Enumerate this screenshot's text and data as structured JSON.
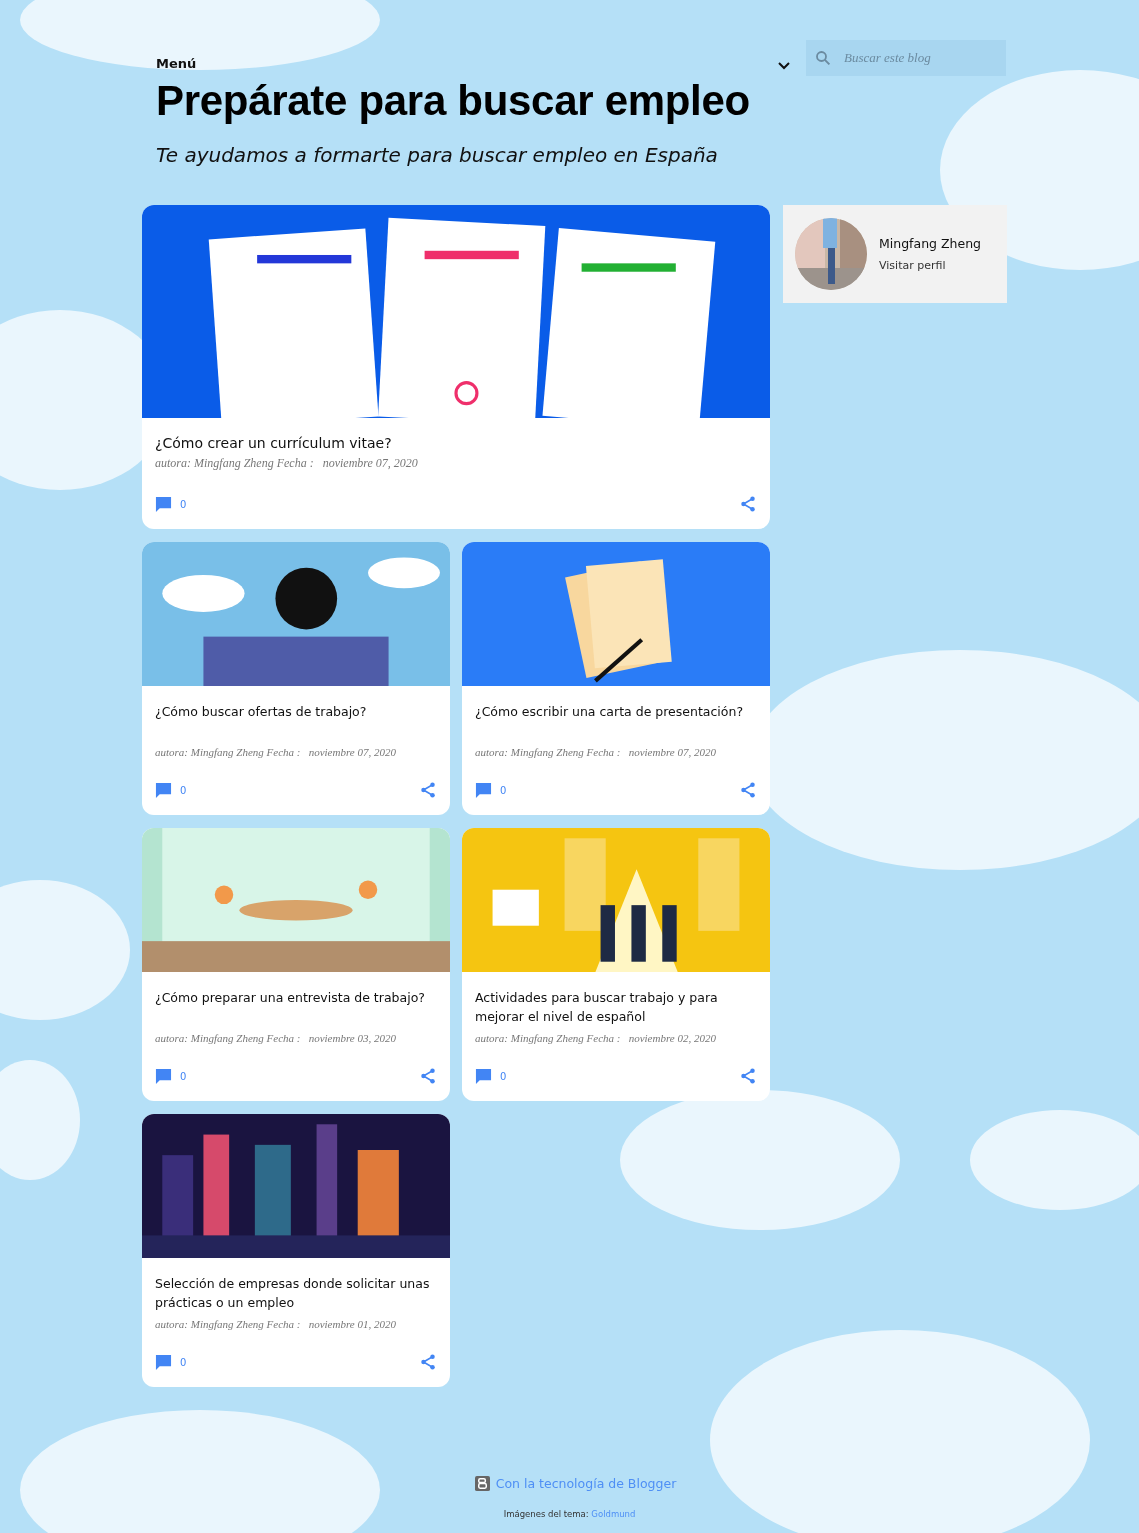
{
  "header": {
    "menu_label": "Menú",
    "title": "Prepárate para buscar empleo",
    "subtitle": "Te ayudamos a formarte para buscar empleo en España"
  },
  "search": {
    "placeholder": "Buscar este blog"
  },
  "profile": {
    "name": "Mingfang Zheng",
    "link": "Visitar perfil"
  },
  "posts": [
    {
      "title": "¿Cómo crear un currículum vitae?",
      "byline": "autora: Mingfang Zheng Fecha :",
      "date": "noviembre 07, 2020",
      "comments": "0",
      "featured": true
    },
    {
      "title": "¿Cómo buscar ofertas de trabajo?",
      "byline": "autora: Mingfang Zheng Fecha :",
      "date": "noviembre 07, 2020",
      "comments": "0",
      "featured": false
    },
    {
      "title": "¿Cómo escribir una carta de presentación?",
      "byline": "autora: Mingfang Zheng Fecha :",
      "date": "noviembre 07, 2020",
      "comments": "0",
      "featured": false
    },
    {
      "title": "¿Cómo preparar una entrevista de trabajo?",
      "byline": "autora: Mingfang Zheng Fecha :",
      "date": "noviembre 03, 2020",
      "comments": "0",
      "featured": false
    },
    {
      "title": "Actividades para buscar trabajo y para mejorar el nivel de español",
      "byline": "autora: Mingfang Zheng Fecha :",
      "date": "noviembre 02, 2020",
      "comments": "0",
      "featured": false
    },
    {
      "title": "Selección de empresas donde solicitar unas prácticas o un empleo",
      "byline": "autora: Mingfang Zheng Fecha :",
      "date": "noviembre 01, 2020",
      "comments": "0",
      "featured": false
    }
  ],
  "footer": {
    "powered": "Con la tecnología de Blogger",
    "credit_label": "Imágenes del tema:",
    "credit_link": "Goldmund"
  }
}
